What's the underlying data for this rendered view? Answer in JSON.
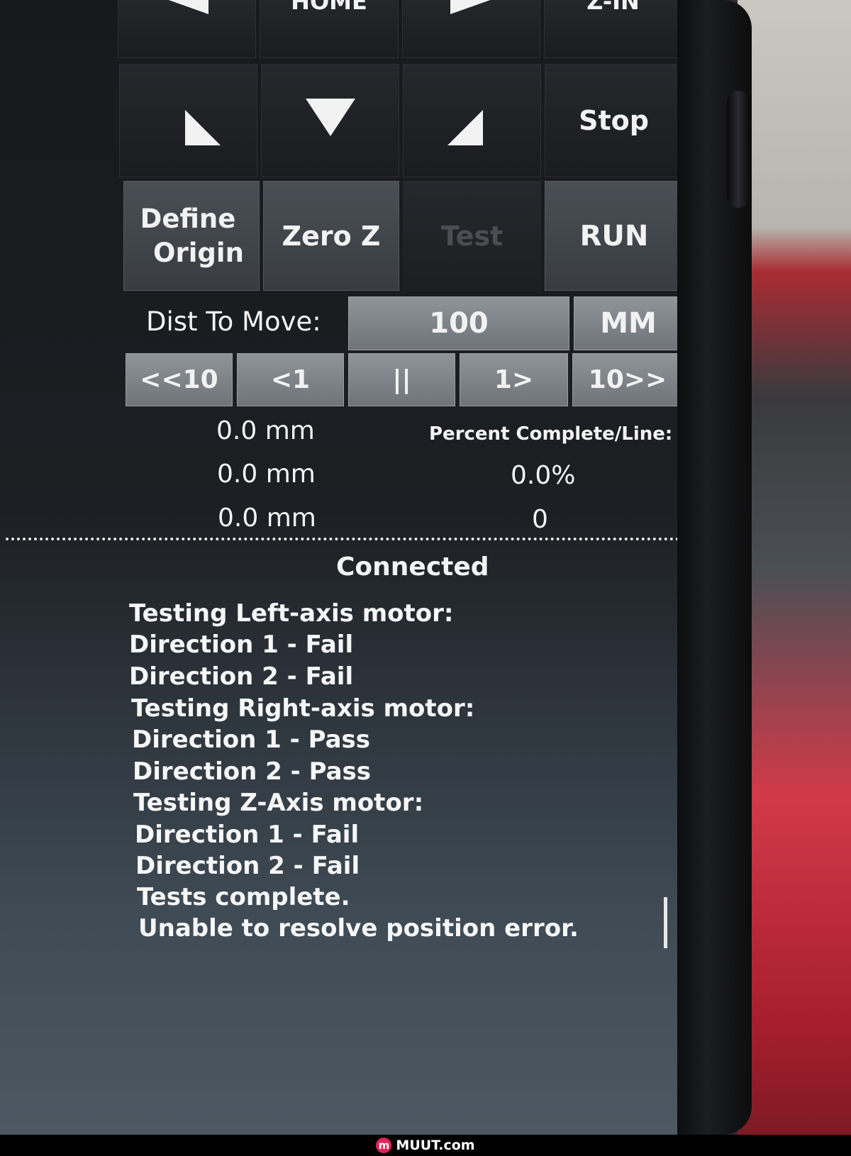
{
  "nav_top": {
    "home_label": "HOME",
    "z_in_label": "Z-IN",
    "left_arrow_icon": "arrow-left-icon",
    "right_arrow_icon": "arrow-right-icon"
  },
  "nav_mid": {
    "down_left_icon": "arrow-down-left-icon",
    "down_icon": "arrow-down-icon",
    "down_right_icon": "arrow-down-right-icon",
    "stop_label": "Stop"
  },
  "actions": {
    "define_origin_label_1": "Define",
    "define_origin_label_2": "Origin",
    "zero_z_label": "Zero Z",
    "test_label": "Test",
    "run_label": "RUN"
  },
  "distance": {
    "label": "Dist To Move:",
    "value": "100",
    "units": "MM"
  },
  "step_controls": {
    "back10": "<<10",
    "back1": "<1",
    "pause": "||",
    "fwd1": "1>",
    "fwd10": "10>>"
  },
  "positions": [
    "0.0 mm",
    "0.0 mm",
    "0.0 mm"
  ],
  "progress": {
    "label": "Percent Complete/Line:",
    "percent": "0.0%",
    "line": "0"
  },
  "status": "Connected",
  "log": [
    "Testing Left-axis motor:",
    "Direction 1 - Fail",
    "Direction 2 - Fail",
    "Testing Right-axis motor:",
    "Direction 1 - Pass",
    "Direction 2 - Pass",
    "Testing Z-Axis motor:",
    "Direction 1 - Fail",
    "Direction 2 - Fail",
    "Tests complete.",
    "Unable to resolve position error."
  ],
  "footer": {
    "logo_letter": "m",
    "site": "MUUT.com"
  },
  "colors": {
    "button_light": "#80858b",
    "button_dark": "#1e2124",
    "text": "#f2f2f2",
    "brand": "#e2245a"
  }
}
